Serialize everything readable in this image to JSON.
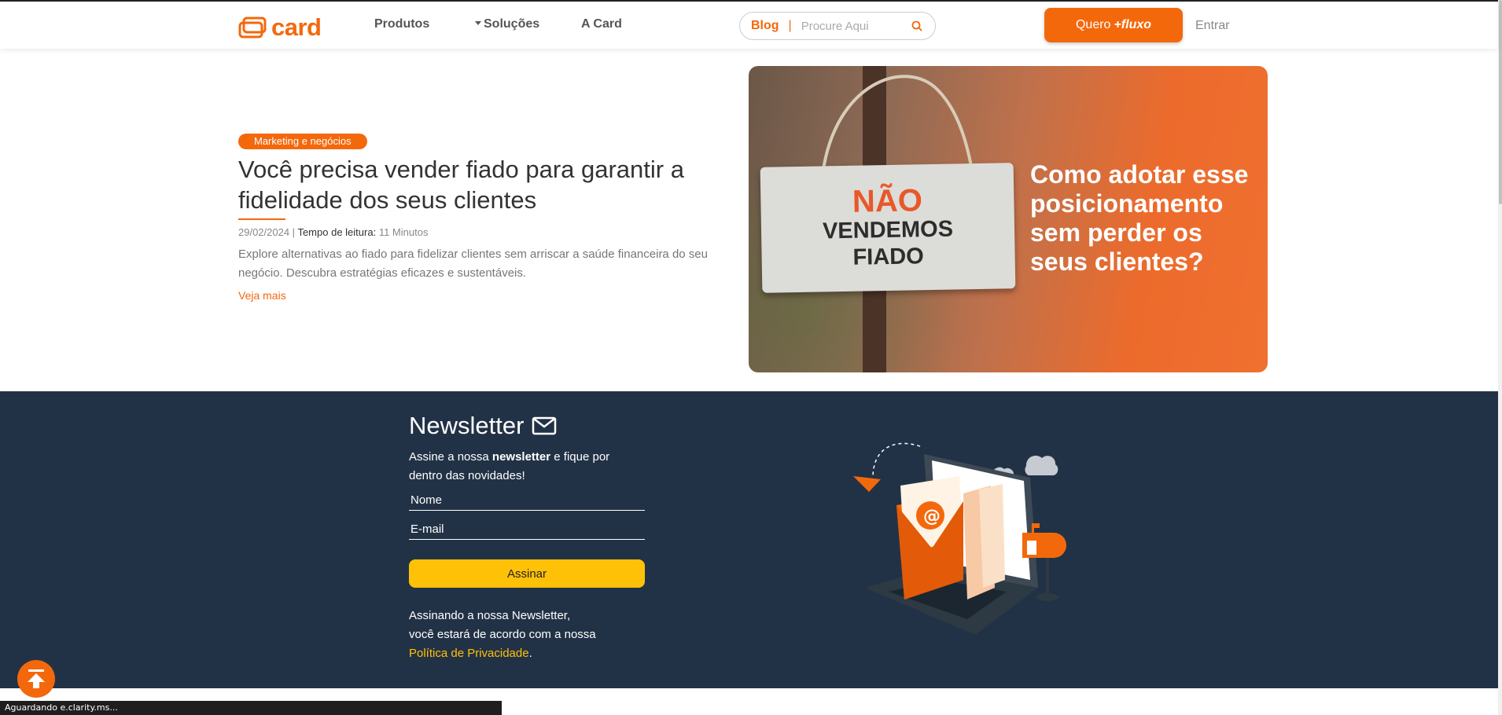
{
  "header": {
    "logo_text": "card",
    "nav": [
      "Produtos",
      "Soluções",
      "A Card"
    ],
    "search_label": "Blog",
    "search_placeholder": "Procure Aqui",
    "cta_prefix": "Quero",
    "cta_emph": "+fluxo",
    "login": "Entrar"
  },
  "article": {
    "tag": "Marketing e negócios",
    "title": "Você precisa vender fiado para garantir a fidelidade dos seus clientes",
    "date": "29/02/2024 |",
    "reading_label": "Tempo de leitura:",
    "reading_time": "11 Minutos",
    "excerpt": "Explore alternativas ao fiado para fidelizar clientes sem arriscar a saúde financeira do seu negócio. Descubra estratégias eficazes e sustentáveis.",
    "more": "Veja mais"
  },
  "hero": {
    "sign_line1": "NÃO",
    "sign_line2": "VENDEMOS",
    "sign_line3": "FIADO",
    "headline": "Como adotar esse posicionamento sem perder os seus clientes?"
  },
  "newsletter": {
    "title": "Newsletter",
    "desc_pre": "Assine a nossa",
    "desc_bold": "newsletter",
    "desc_post": "e fique por dentro das novidades!",
    "name_placeholder": "Nome",
    "email_placeholder": "E-mail",
    "button": "Assinar",
    "legal_line1": "Assinando a nossa Newsletter,",
    "legal_line2": "você estará de acordo com a nossa",
    "legal_link": "Política de Privacidade",
    "legal_end": "."
  },
  "status_bar": "Aguardando e.clarity.ms...",
  "colors": {
    "brand_orange": "#f4680c",
    "navy": "#223246",
    "yellow": "#ffc107"
  }
}
